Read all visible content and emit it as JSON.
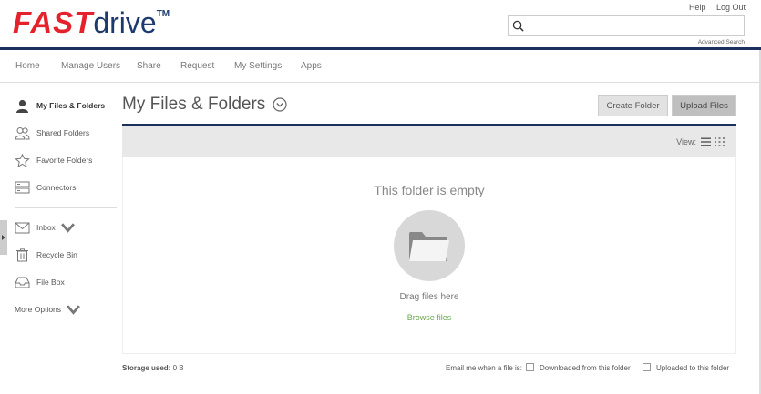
{
  "brand": {
    "logo_fast": "FAST",
    "logo_drive": "drive",
    "logo_tm": "TM"
  },
  "header": {
    "links": [
      "Help",
      "Log Out"
    ],
    "search": {
      "value": "",
      "placeholder": "",
      "advanced_label": "Advanced Search"
    }
  },
  "nav": {
    "items": [
      "Home",
      "Manage Users",
      "Share",
      "Request",
      "My Settings",
      "Apps"
    ]
  },
  "sidebar": {
    "items": [
      {
        "label": "My Files & Folders",
        "icon": "user-icon",
        "active": true
      },
      {
        "label": "Shared Folders",
        "icon": "users-icon"
      },
      {
        "label": "Favorite Folders",
        "icon": "star-icon"
      },
      {
        "label": "Connectors",
        "icon": "connector-icon"
      },
      {
        "label": "Inbox",
        "icon": "envelope-icon"
      },
      {
        "label": "Recycle Bin",
        "icon": "trash-icon"
      },
      {
        "label": "File Box",
        "icon": "tray-icon"
      }
    ],
    "more_options": "More Options"
  },
  "main": {
    "title": "My Files & Folders",
    "buttons": {
      "create": "Create Folder",
      "upload": "Upload Files"
    },
    "view_label": "View:",
    "empty_title": "This folder is empty",
    "drag_text": "Drag files here",
    "browse_text": "Browse files"
  },
  "footer": {
    "storage_label": "Storage used:",
    "storage_value": "0 B",
    "email_label": "Email me when a file is:",
    "opt_downloaded": "Downloaded from this folder",
    "opt_uploaded": "Uploaded to this folder"
  },
  "colors": {
    "brand_red": "#e5222b",
    "brand_navy": "#1d3a6e",
    "rule": "#1d2f5c",
    "link_green": "#6aa84f"
  }
}
